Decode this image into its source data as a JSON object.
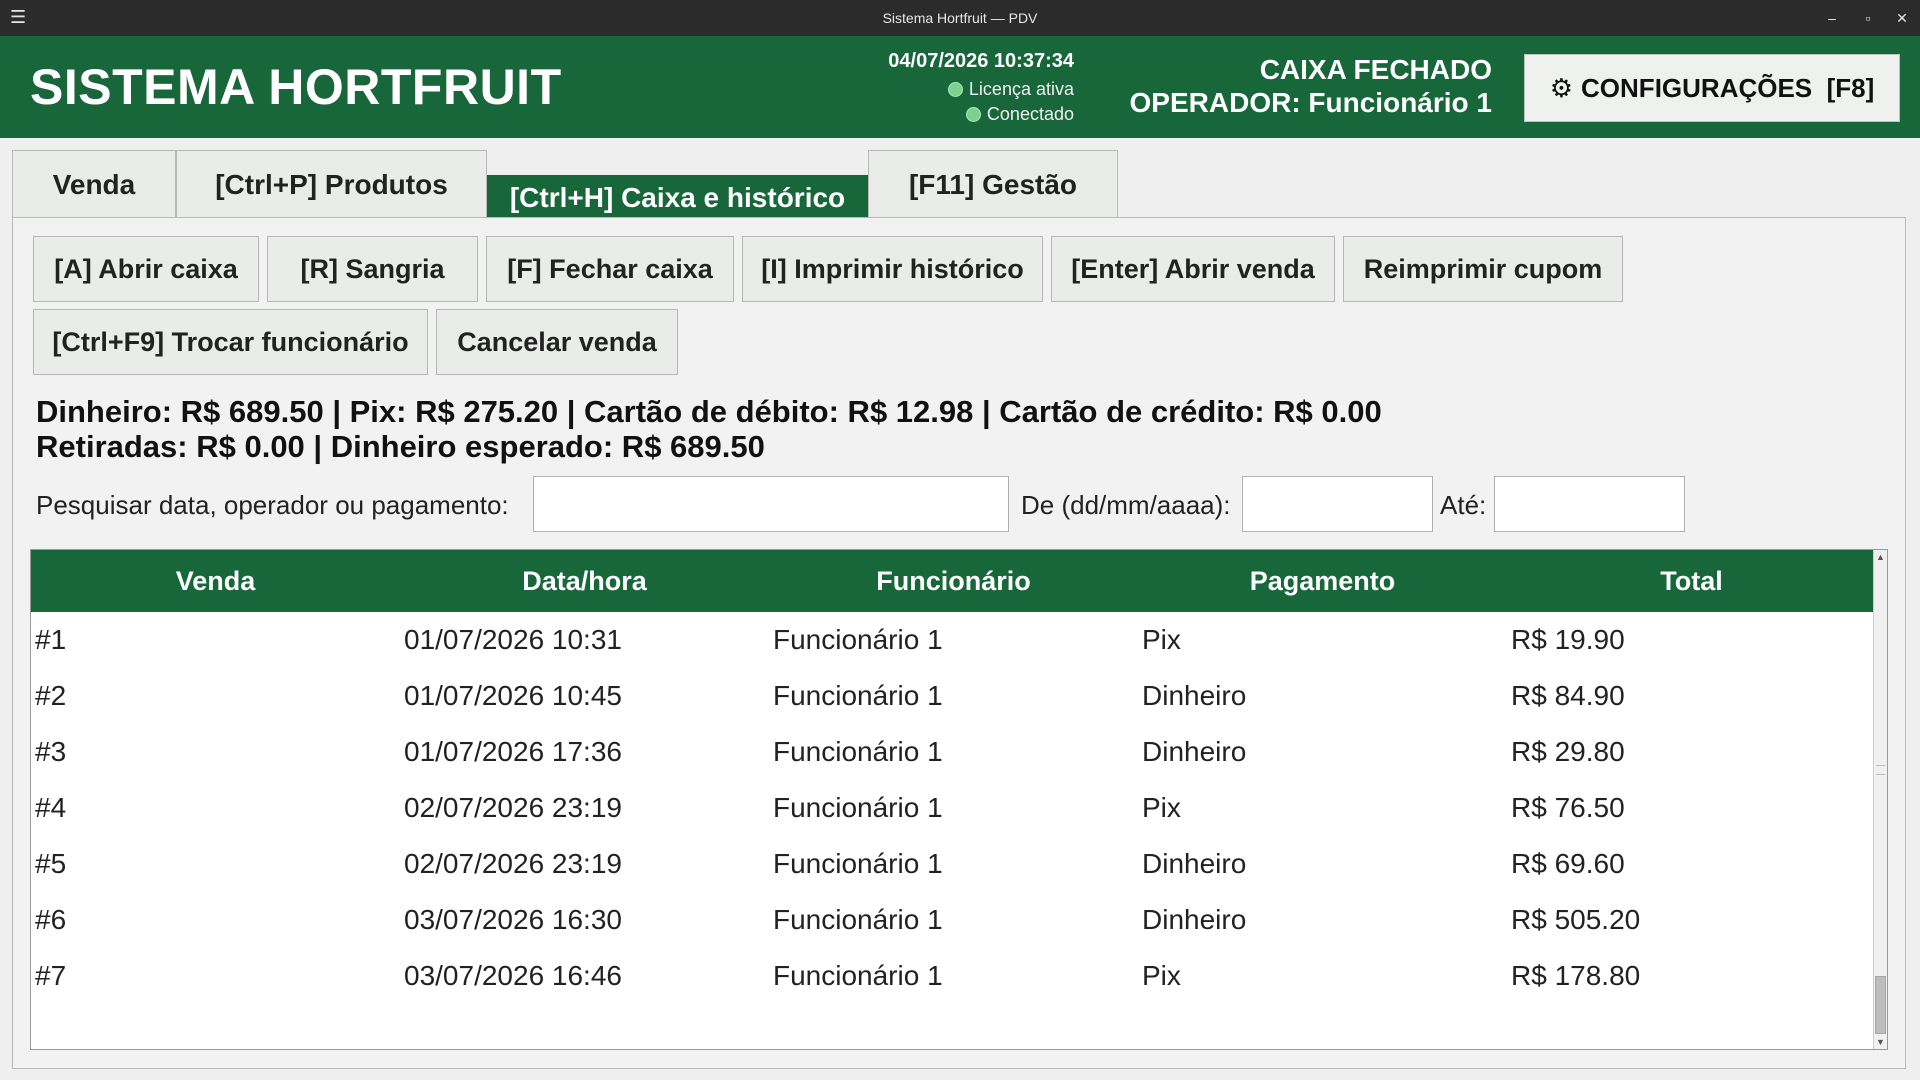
{
  "window": {
    "title": "Sistema Hortfruit — PDV",
    "menu_icon": "☰",
    "minimize": "–",
    "maximize": "▫",
    "close": "✕"
  },
  "header": {
    "app_title": "SISTEMA HORTFRUIT",
    "datetime": "04/07/2026 10:37:34",
    "license_status": "Licença ativa",
    "connection_status": "Conectado",
    "caixa_status": "CAIXA FECHADO",
    "operator": "OPERADOR: Funcionário 1",
    "config_icon": "⚙",
    "config_label": "CONFIGURAÇÕES  [F8]",
    "brand_color": "#17673a",
    "status_dot_color": "#7fd08f"
  },
  "tabs": [
    {
      "label": "Venda",
      "active": false
    },
    {
      "label": "[Ctrl+P] Produtos",
      "active": false
    },
    {
      "label": "[Ctrl+H] Caixa e histórico",
      "active": true
    },
    {
      "label": "[F11] Gestão",
      "active": false
    }
  ],
  "actions": {
    "abrir_caixa": "[A] Abrir caixa",
    "sangria": "[R] Sangria",
    "fechar_caixa": "[F] Fechar caixa",
    "imprimir_historico": "[I] Imprimir histórico",
    "abrir_venda": "[Enter] Abrir venda",
    "reimprimir_cupom": "Reimprimir cupom",
    "trocar_funcionario": "[Ctrl+F9] Trocar funcionário",
    "cancelar_venda": "Cancelar venda"
  },
  "summary": {
    "line1": "Dinheiro: R$ 689.50 | Pix: R$ 275.20 | Cartão de débito: R$ 12.98 | Cartão de crédito: R$ 0.00",
    "line2": "Retiradas: R$ 0.00 | Dinheiro esperado: R$ 689.50"
  },
  "filters": {
    "search_label": "Pesquisar data, operador ou pagamento:",
    "search_value": "",
    "from_label": "De (dd/mm/aaaa):",
    "from_value": "",
    "to_label": "Até:",
    "to_value": ""
  },
  "table": {
    "columns": [
      "Venda",
      "Data/hora",
      "Funcionário",
      "Pagamento",
      "Total"
    ],
    "rows": [
      [
        "#1",
        "01/07/2026 10:31",
        "Funcionário 1",
        "Pix",
        "R$ 19.90"
      ],
      [
        "#2",
        "01/07/2026 10:45",
        "Funcionário 1",
        "Dinheiro",
        "R$ 84.90"
      ],
      [
        "#3",
        "01/07/2026 17:36",
        "Funcionário 1",
        "Dinheiro",
        "R$ 29.80"
      ],
      [
        "#4",
        "02/07/2026 23:19",
        "Funcionário 1",
        "Pix",
        "R$ 76.50"
      ],
      [
        "#5",
        "02/07/2026 23:19",
        "Funcionário 1",
        "Dinheiro",
        "R$ 69.60"
      ],
      [
        "#6",
        "03/07/2026 16:30",
        "Funcionário 1",
        "Dinheiro",
        "R$ 505.20"
      ],
      [
        "#7",
        "03/07/2026 16:46",
        "Funcionário 1",
        "Pix",
        "R$ 178.80"
      ]
    ]
  }
}
